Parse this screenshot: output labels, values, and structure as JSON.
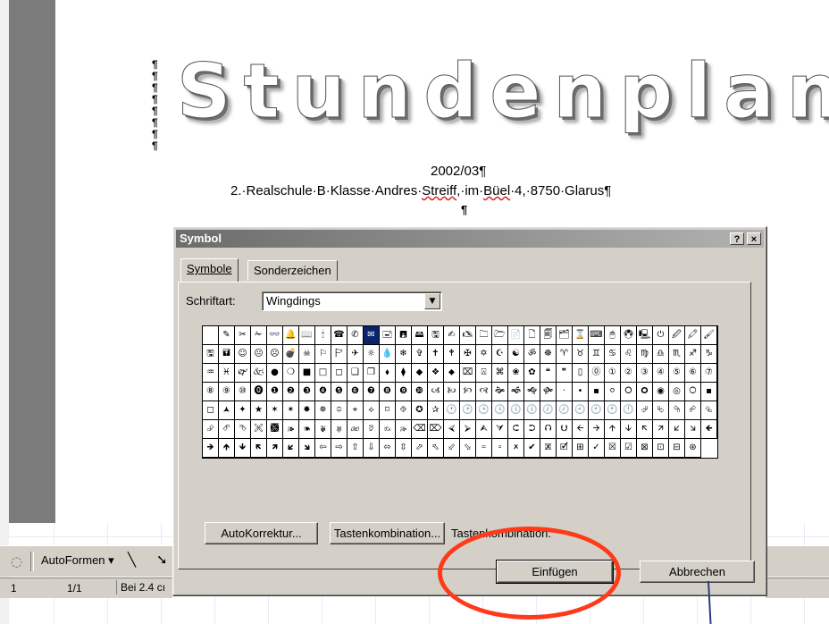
{
  "document": {
    "pilcrows": [
      "¶",
      "¶",
      "¶",
      "¶",
      "¶",
      "¶",
      "¶",
      "¶"
    ],
    "title_art": "Stundenplan",
    "year": "2002/03¶",
    "address_parts": [
      "2.·Realschule·B·Klasse·Andres·",
      "Streiff",
      ",·im·",
      "Büel",
      "·4,·8750·Glarus¶"
    ],
    "para_mark": "¶"
  },
  "dialog": {
    "title": "Symbol",
    "help_label": "?",
    "close_label": "×",
    "tabs": [
      {
        "label": "Symbole",
        "selected": true
      },
      {
        "label": "Sonderzeichen",
        "selected": false
      }
    ],
    "font_label": "Schriftart:",
    "font_value": "Wingdings",
    "dropdown_arrow": "▼",
    "symbols": [
      " ",
      "✎",
      "✂",
      "✁",
      "👓",
      "🔔",
      "📖",
      "🕯",
      "☎",
      "✆",
      "✉",
      "🖃",
      "🖪",
      "🖴",
      "🖫",
      "✍",
      "🖎",
      "🗀",
      "🗁",
      "📄",
      "🗋",
      "🗐",
      "🗂",
      "⌛",
      "⌨",
      "🖱",
      "🖲",
      "🖳",
      "⏻",
      "🖉",
      "🖍",
      "🖌",
      "🖫",
      "🖬",
      "☺",
      "😐",
      "☹",
      "💣",
      "☠",
      "⚐",
      "🏱",
      "✈",
      "☼",
      "💧",
      "❄",
      "✞",
      "✝",
      "🕈",
      "✠",
      "✡",
      "☪",
      "☯",
      "ॐ",
      "☸",
      "♈",
      "♉",
      "♊",
      "♋",
      "♌",
      "♍",
      "♎",
      "♏",
      "♐",
      "♑",
      "♒",
      "♓",
      "🙰",
      "🙵",
      "●",
      "❍",
      "■",
      "□",
      "◻",
      "❑",
      "❒",
      "⬧",
      "⧫",
      "◆",
      "❖",
      "⬥",
      "⌧",
      "⍓",
      "⌘",
      "❀",
      "✿",
      "❝",
      "❞",
      "▯",
      "⓪",
      "①",
      "②",
      "③",
      "④",
      "⑤",
      "⑥",
      "⑦",
      "⑧",
      "⑨",
      "⑩",
      "⓿",
      "❶",
      "❷",
      "❸",
      "❹",
      "❺",
      "❻",
      "❼",
      "❽",
      "❾",
      "❿",
      "🙢",
      "🙠",
      "🙡",
      "🙣",
      "🙞",
      "🙜",
      "🙝",
      "🙟",
      "·",
      "•",
      "▪",
      "⚪",
      "🞆",
      "🞈",
      "◉",
      "◎",
      "🞅",
      "▪",
      "◻",
      "🟂",
      "✦",
      "★",
      "✶",
      "✴",
      "✹",
      "✵",
      "⯐",
      "⌖",
      "⟡",
      "⌑",
      "⯑",
      "✪",
      "✰",
      "🕐",
      "🕑",
      "🕒",
      "🕓",
      "🕔",
      "🕕",
      "🕖",
      "🕗",
      "🕘",
      "🕙",
      "🕚",
      "🕛",
      "⮰",
      "⮱",
      "⮲",
      "⮳",
      "⮴",
      "⮵",
      "⮶",
      "⮷",
      "🙪",
      "🙫",
      "🙕",
      "🙔",
      "🙗",
      "🙖",
      "🙐",
      "🙑",
      "🙒",
      "🙓",
      "⌫",
      "⌦",
      "⮘",
      "⮚",
      "⮙",
      "⮛",
      "⮈",
      "⮊",
      "⮉",
      "⮋",
      "🡨",
      "🡪",
      "🡩",
      "🡫",
      "🡬",
      "🡭",
      "🡯",
      "🡮",
      "🡸",
      "🡺",
      "🡹",
      "🡻",
      "🡼",
      "🡽",
      "🡿",
      "🡾",
      "⇦",
      "⇨",
      "⇧",
      "⇩",
      "⬄",
      "⇳",
      "⬀",
      "⬁",
      "⬃",
      "⬂",
      "🢬",
      "🢭",
      "🗶",
      "✔",
      "🗷",
      "🗹",
      "⊞",
      "✓",
      "☒",
      "☑",
      "⊠",
      "⊡",
      "⊟",
      "⊛"
    ],
    "selected_index": 10,
    "btn_autokorrektur": "AutoKorrektur...",
    "btn_tastenkombination": "Tastenkombination...",
    "shortcut_label": "Tastenkombination:",
    "btn_einfuegen": "Einfügen",
    "btn_abbrechen": "Abbrechen"
  },
  "toolbar": {
    "draw_icon": "◌",
    "autoformen": "AutoFormen ▾",
    "line_tool": "╲",
    "arrow_tool": "➘"
  },
  "status": {
    "page": "1",
    "page_count": "1/1",
    "position": "Bei 2.4 cı"
  },
  "colors": {
    "dialog_bg": "#d4d0c8",
    "title_gradient_start": "#6c6c6c",
    "selection": "#0a246a",
    "annotation": "#ff3a1a"
  }
}
